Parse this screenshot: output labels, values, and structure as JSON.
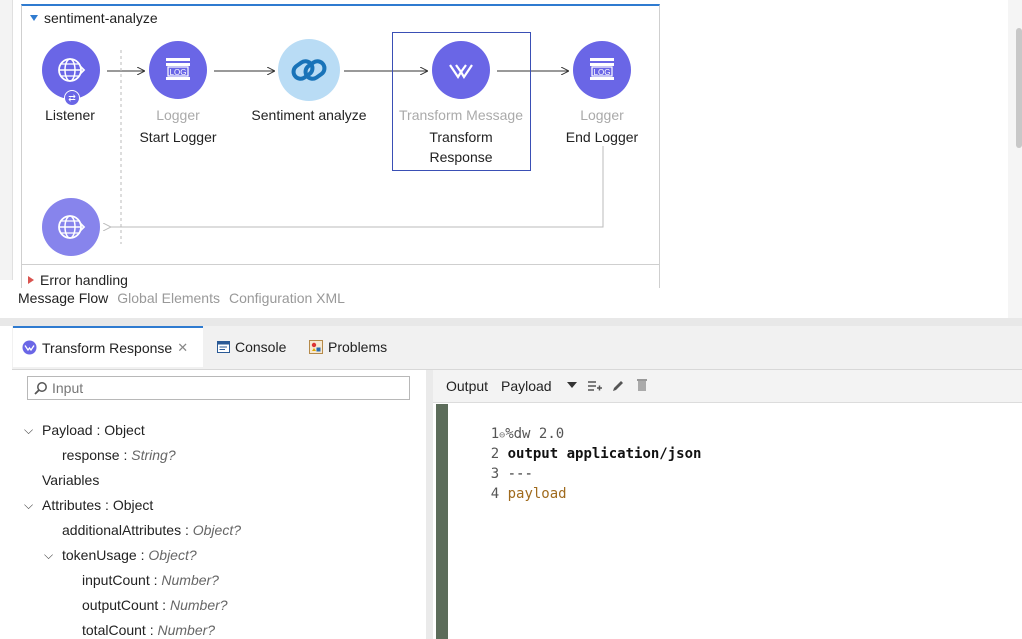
{
  "flow": {
    "name": "sentiment-analyze",
    "error_handling": "Error handling",
    "nodes": [
      {
        "type": "",
        "name": "Listener"
      },
      {
        "type": "Logger",
        "name": "Start Logger"
      },
      {
        "type": "",
        "name": "Sentiment analyze"
      },
      {
        "type": "Transform Message",
        "name": "Transform Response"
      },
      {
        "type": "Logger",
        "name": "End Logger"
      }
    ],
    "log_text": "LOG"
  },
  "canvas_tabs": [
    "Message Flow",
    "Global Elements",
    "Configuration XML"
  ],
  "panel_tabs": [
    {
      "label": "Transform Response",
      "icon": "transform-icon"
    },
    {
      "label": "Console",
      "icon": "console-icon"
    },
    {
      "label": "Problems",
      "icon": "problems-icon"
    }
  ],
  "input_panel": {
    "search_placeholder": "Input",
    "tree": {
      "payload": {
        "name": "Payload",
        "type": "Object"
      },
      "response": {
        "name": "response",
        "type": "String?"
      },
      "variables": "Variables",
      "attributes": {
        "name": "Attributes",
        "type": "Object"
      },
      "additional": {
        "name": "additionalAttributes",
        "type": "Object?"
      },
      "token_usage": {
        "name": "tokenUsage",
        "type": "Object?"
      },
      "input_count": {
        "name": "inputCount",
        "type": "Number?"
      },
      "output_count": {
        "name": "outputCount",
        "type": "Number?"
      },
      "total_count": {
        "name": "totalCount",
        "type": "Number?"
      }
    }
  },
  "output_panel": {
    "label": "Output",
    "target": "Payload",
    "code": [
      {
        "n": "1",
        "text": "%dw 2.0"
      },
      {
        "n": "2",
        "text": "output application/json"
      },
      {
        "n": "3",
        "text": "---"
      },
      {
        "n": "4",
        "text": "payload"
      }
    ]
  },
  "colors": {
    "node": "#6a66e6",
    "accent": "#2f7bd0",
    "code_keyword": "#a06b1e"
  }
}
